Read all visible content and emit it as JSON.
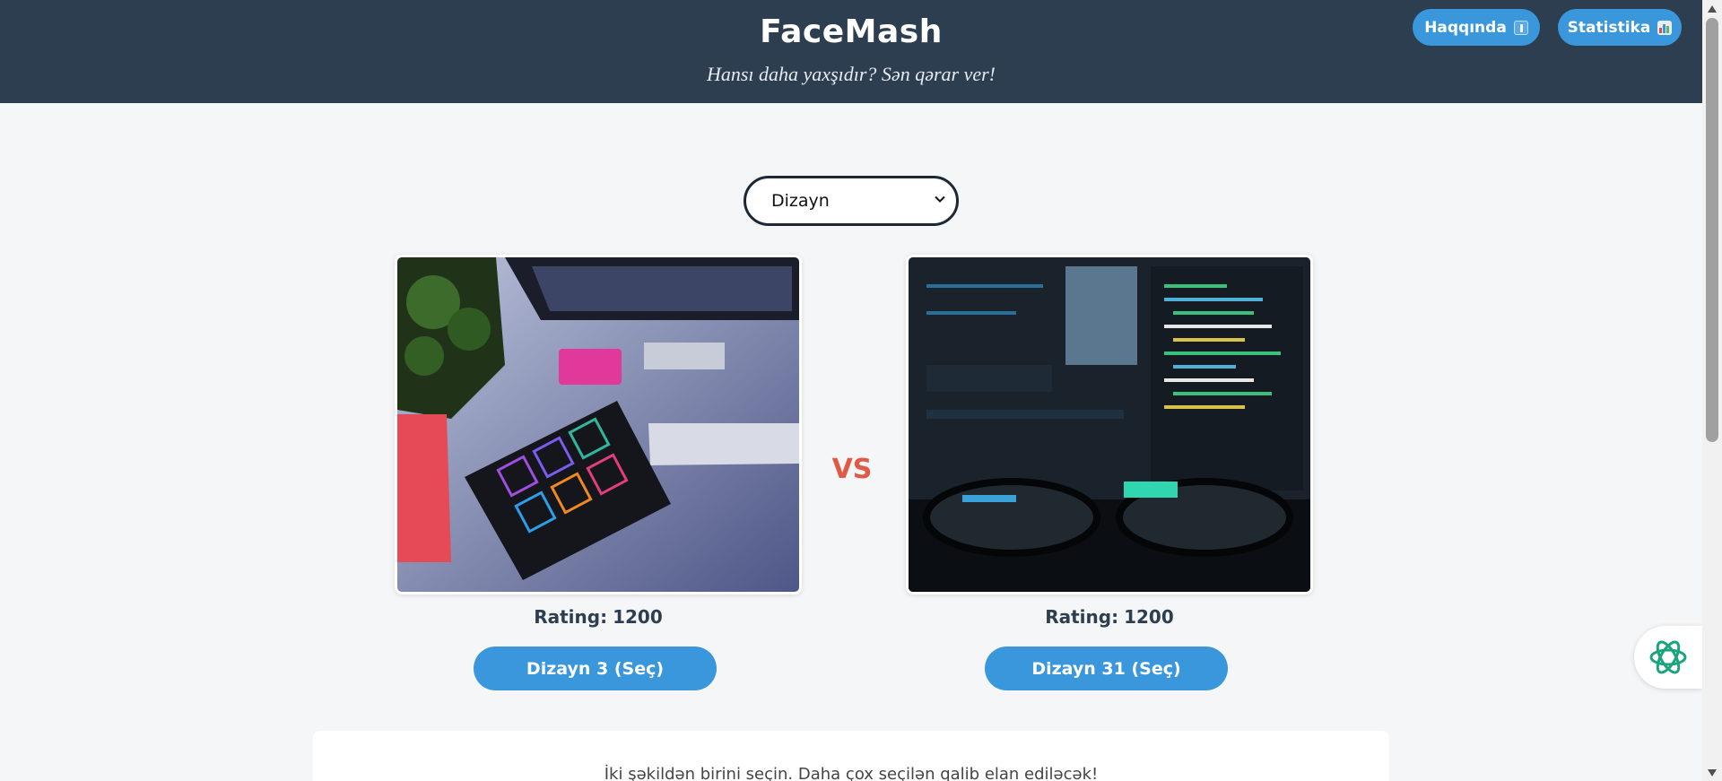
{
  "header": {
    "title": "FaceMash",
    "subtitle": "Hansı daha yaxşıdır? Sən qərar ver!",
    "nav": {
      "about_label": "Haqqında",
      "about_icon": "info-icon",
      "stats_label": "Statistika",
      "stats_icon": "bar-chart-icon"
    }
  },
  "category_select": {
    "selected": "Dizayn"
  },
  "left": {
    "image_icon": "design-desk-image",
    "rating_label": "Rating:",
    "rating_value": "1200",
    "button_label": "Dizayn 3 (Seç)"
  },
  "vs_label": "VS",
  "right": {
    "image_icon": "code-screen-image",
    "rating_label": "Rating:",
    "rating_value": "1200",
    "button_label": "Dizayn 31 (Seç)"
  },
  "info": {
    "text": "İki şəkildən birini seçin. Daha çox seçilən qalib elan ediləcək!"
  },
  "colors": {
    "header_bg": "#2c3e50",
    "accent": "#3b97dc",
    "vs": "#e05a45",
    "page_bg": "#f5f6f8"
  }
}
